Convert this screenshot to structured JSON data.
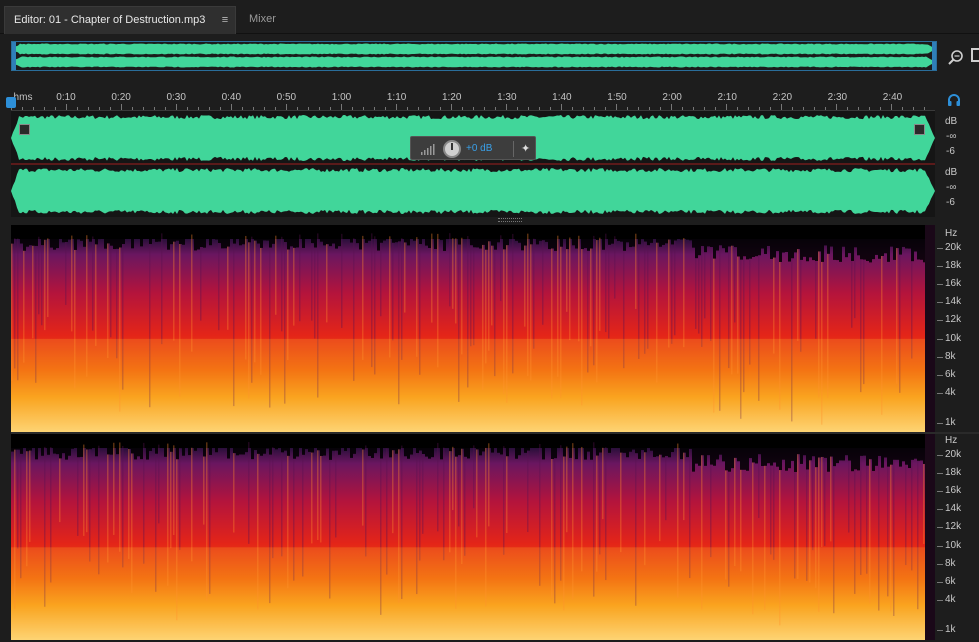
{
  "tabs": {
    "editor_label": "Editor: 01 - Chapter of Destruction.mp3",
    "mixer_label": "Mixer"
  },
  "ruler": {
    "unit": "hms",
    "ticks": [
      "0:10",
      "0:20",
      "0:30",
      "0:40",
      "0:50",
      "1:00",
      "1:10",
      "1:20",
      "1:30",
      "1:40",
      "1:50",
      "2:00",
      "2:10",
      "2:20",
      "2:30",
      "2:40"
    ]
  },
  "gain_hud": {
    "value": "+0 dB"
  },
  "waveform_scale": {
    "unit": "dB",
    "minus_inf": "-∞",
    "minus_six": "-6"
  },
  "spectral_scale": {
    "unit": "Hz",
    "labels": [
      "20k",
      "18k",
      "16k",
      "14k",
      "12k",
      "10k",
      "8k",
      "6k",
      "4k",
      "1k"
    ]
  },
  "icons": {
    "tab_menu": "hamburger-icon",
    "zoom": "zoom-icon",
    "monitor": "headphone-icon",
    "pin": "pin-icon"
  },
  "colors": {
    "waveform": "#41d69a",
    "accent": "#2d8fd8",
    "gain_value": "#3aa0e8"
  }
}
